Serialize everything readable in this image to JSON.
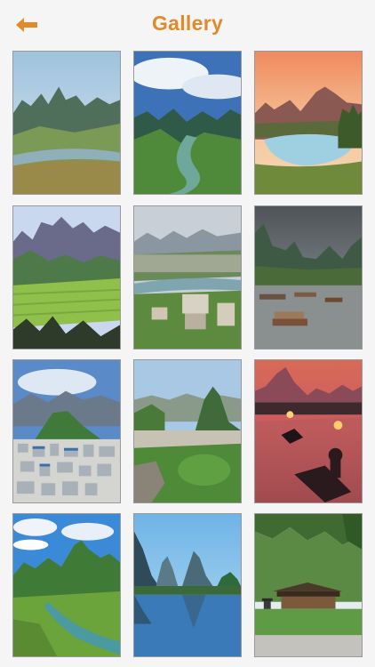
{
  "header": {
    "title": "Gallery",
    "back_icon": "back-arrow-icon",
    "accent": "#e08a2a"
  },
  "gallery": {
    "items": [
      {
        "scene": "karst-peaks-river-valley"
      },
      {
        "scene": "river-bend-between-karst-hills"
      },
      {
        "scene": "sunset-lake-with-karst-peaks"
      },
      {
        "scene": "karst-mountains-over-rice-fields"
      },
      {
        "scene": "town-along-river-with-hills"
      },
      {
        "scene": "river-boats-under-cloudy-sky"
      },
      {
        "scene": "city-below-karst-hill"
      },
      {
        "scene": "town-with-karst-peak-and-greenery"
      },
      {
        "scene": "cormorant-fisherman-at-dusk"
      },
      {
        "scene": "green-karst-peaks-and-river"
      },
      {
        "scene": "karst-peaks-reflected-in-river"
      },
      {
        "scene": "pagoda-park-with-pavilion"
      }
    ]
  }
}
